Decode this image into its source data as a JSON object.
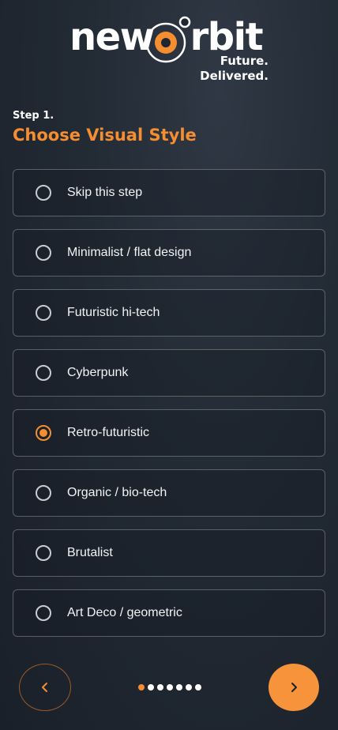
{
  "brand": {
    "word_left": "new",
    "word_right": "rbit",
    "tagline_line1": "Future.",
    "tagline_line2": "Delivered.",
    "accent_color": "#f58d31"
  },
  "step": {
    "label": "Step 1.",
    "title": "Choose Visual Style"
  },
  "options": [
    {
      "label": "Skip this step",
      "selected": false
    },
    {
      "label": "Minimalist / flat design",
      "selected": false
    },
    {
      "label": "Futuristic hi-tech",
      "selected": false
    },
    {
      "label": "Cyberpunk",
      "selected": false
    },
    {
      "label": "Retro-futuristic",
      "selected": true
    },
    {
      "label": "Organic / bio-tech",
      "selected": false
    },
    {
      "label": "Brutalist",
      "selected": false
    },
    {
      "label": "Art Deco / geometric",
      "selected": false
    }
  ],
  "navigation": {
    "prev_icon": "chevron-left-icon",
    "next_icon": "chevron-right-icon",
    "total_steps": 7,
    "current_step": 1
  }
}
